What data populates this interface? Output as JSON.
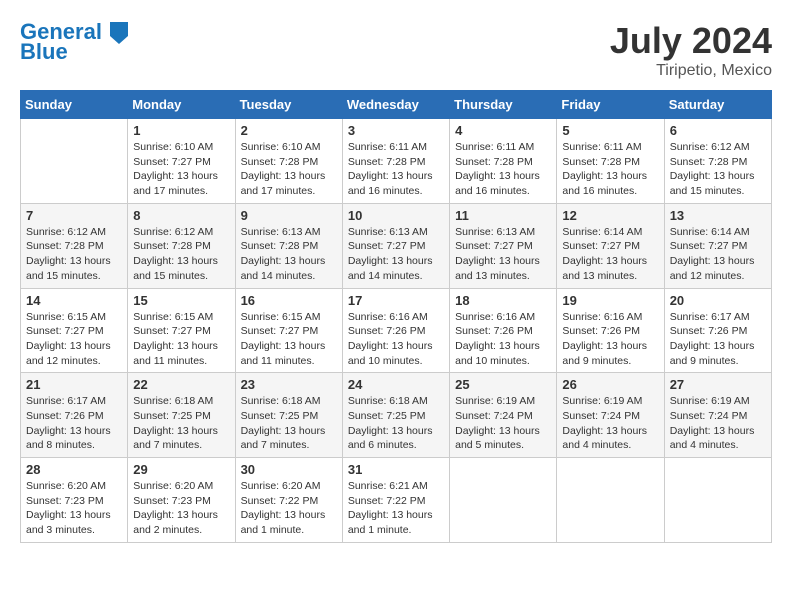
{
  "header": {
    "logo_line1": "General",
    "logo_line2": "Blue",
    "month_year": "July 2024",
    "location": "Tiripetio, Mexico"
  },
  "days_of_week": [
    "Sunday",
    "Monday",
    "Tuesday",
    "Wednesday",
    "Thursday",
    "Friday",
    "Saturday"
  ],
  "weeks": [
    [
      {
        "num": "",
        "info": ""
      },
      {
        "num": "1",
        "info": "Sunrise: 6:10 AM\nSunset: 7:27 PM\nDaylight: 13 hours\nand 17 minutes."
      },
      {
        "num": "2",
        "info": "Sunrise: 6:10 AM\nSunset: 7:28 PM\nDaylight: 13 hours\nand 17 minutes."
      },
      {
        "num": "3",
        "info": "Sunrise: 6:11 AM\nSunset: 7:28 PM\nDaylight: 13 hours\nand 16 minutes."
      },
      {
        "num": "4",
        "info": "Sunrise: 6:11 AM\nSunset: 7:28 PM\nDaylight: 13 hours\nand 16 minutes."
      },
      {
        "num": "5",
        "info": "Sunrise: 6:11 AM\nSunset: 7:28 PM\nDaylight: 13 hours\nand 16 minutes."
      },
      {
        "num": "6",
        "info": "Sunrise: 6:12 AM\nSunset: 7:28 PM\nDaylight: 13 hours\nand 15 minutes."
      }
    ],
    [
      {
        "num": "7",
        "info": "Sunrise: 6:12 AM\nSunset: 7:28 PM\nDaylight: 13 hours\nand 15 minutes."
      },
      {
        "num": "8",
        "info": "Sunrise: 6:12 AM\nSunset: 7:28 PM\nDaylight: 13 hours\nand 15 minutes."
      },
      {
        "num": "9",
        "info": "Sunrise: 6:13 AM\nSunset: 7:28 PM\nDaylight: 13 hours\nand 14 minutes."
      },
      {
        "num": "10",
        "info": "Sunrise: 6:13 AM\nSunset: 7:27 PM\nDaylight: 13 hours\nand 14 minutes."
      },
      {
        "num": "11",
        "info": "Sunrise: 6:13 AM\nSunset: 7:27 PM\nDaylight: 13 hours\nand 13 minutes."
      },
      {
        "num": "12",
        "info": "Sunrise: 6:14 AM\nSunset: 7:27 PM\nDaylight: 13 hours\nand 13 minutes."
      },
      {
        "num": "13",
        "info": "Sunrise: 6:14 AM\nSunset: 7:27 PM\nDaylight: 13 hours\nand 12 minutes."
      }
    ],
    [
      {
        "num": "14",
        "info": "Sunrise: 6:15 AM\nSunset: 7:27 PM\nDaylight: 13 hours\nand 12 minutes."
      },
      {
        "num": "15",
        "info": "Sunrise: 6:15 AM\nSunset: 7:27 PM\nDaylight: 13 hours\nand 11 minutes."
      },
      {
        "num": "16",
        "info": "Sunrise: 6:15 AM\nSunset: 7:27 PM\nDaylight: 13 hours\nand 11 minutes."
      },
      {
        "num": "17",
        "info": "Sunrise: 6:16 AM\nSunset: 7:26 PM\nDaylight: 13 hours\nand 10 minutes."
      },
      {
        "num": "18",
        "info": "Sunrise: 6:16 AM\nSunset: 7:26 PM\nDaylight: 13 hours\nand 10 minutes."
      },
      {
        "num": "19",
        "info": "Sunrise: 6:16 AM\nSunset: 7:26 PM\nDaylight: 13 hours\nand 9 minutes."
      },
      {
        "num": "20",
        "info": "Sunrise: 6:17 AM\nSunset: 7:26 PM\nDaylight: 13 hours\nand 9 minutes."
      }
    ],
    [
      {
        "num": "21",
        "info": "Sunrise: 6:17 AM\nSunset: 7:26 PM\nDaylight: 13 hours\nand 8 minutes."
      },
      {
        "num": "22",
        "info": "Sunrise: 6:18 AM\nSunset: 7:25 PM\nDaylight: 13 hours\nand 7 minutes."
      },
      {
        "num": "23",
        "info": "Sunrise: 6:18 AM\nSunset: 7:25 PM\nDaylight: 13 hours\nand 7 minutes."
      },
      {
        "num": "24",
        "info": "Sunrise: 6:18 AM\nSunset: 7:25 PM\nDaylight: 13 hours\nand 6 minutes."
      },
      {
        "num": "25",
        "info": "Sunrise: 6:19 AM\nSunset: 7:24 PM\nDaylight: 13 hours\nand 5 minutes."
      },
      {
        "num": "26",
        "info": "Sunrise: 6:19 AM\nSunset: 7:24 PM\nDaylight: 13 hours\nand 4 minutes."
      },
      {
        "num": "27",
        "info": "Sunrise: 6:19 AM\nSunset: 7:24 PM\nDaylight: 13 hours\nand 4 minutes."
      }
    ],
    [
      {
        "num": "28",
        "info": "Sunrise: 6:20 AM\nSunset: 7:23 PM\nDaylight: 13 hours\nand 3 minutes."
      },
      {
        "num": "29",
        "info": "Sunrise: 6:20 AM\nSunset: 7:23 PM\nDaylight: 13 hours\nand 2 minutes."
      },
      {
        "num": "30",
        "info": "Sunrise: 6:20 AM\nSunset: 7:22 PM\nDaylight: 13 hours\nand 1 minute."
      },
      {
        "num": "31",
        "info": "Sunrise: 6:21 AM\nSunset: 7:22 PM\nDaylight: 13 hours\nand 1 minute."
      },
      {
        "num": "",
        "info": ""
      },
      {
        "num": "",
        "info": ""
      },
      {
        "num": "",
        "info": ""
      }
    ]
  ]
}
